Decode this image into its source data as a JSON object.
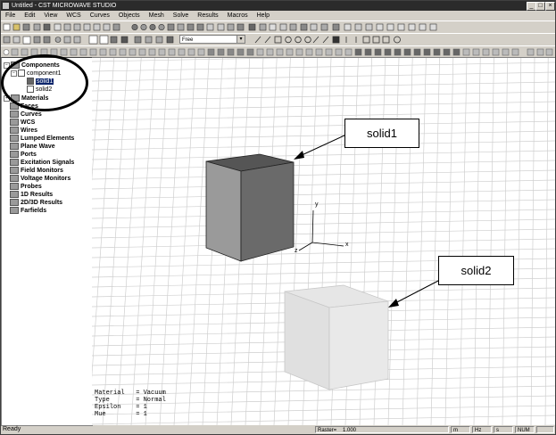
{
  "titlebar": {
    "title": "Untitled - CST MICROWAVE STUDIO",
    "min": "_",
    "max": "□",
    "close": "×"
  },
  "menu": [
    "File",
    "Edit",
    "View",
    "WCS",
    "Curves",
    "Objects",
    "Mesh",
    "Solve",
    "Results",
    "Macros",
    "Help"
  ],
  "toolbar": {
    "view_combo": "Free"
  },
  "tree": {
    "components": "Components",
    "component1": "component1",
    "solid1": "solid1",
    "solid2": "solid2",
    "folders": [
      "Materials",
      "Faces",
      "Curves",
      "WCS",
      "Wires",
      "Lumped Elements",
      "Plane Wave",
      "Ports",
      "Excitation Signals",
      "Field Monitors",
      "Voltage Monitors",
      "Probes",
      "1D Results",
      "2D/3D Results",
      "Farfields"
    ]
  },
  "view": {
    "callout1": "solid1",
    "callout2": "solid2",
    "axis_x": "x",
    "axis_y": "y",
    "axis_z": "z",
    "props": "Material   = Vacuum\nType       = Normal\nEpsilon    = 1\nMue        = 1"
  },
  "status": {
    "ready": "Ready",
    "raster_label": "Raster=",
    "raster_value": "1.000",
    "unit_m": "m",
    "unit_hz": "Hz",
    "unit_s": "s",
    "num": "NUM"
  }
}
